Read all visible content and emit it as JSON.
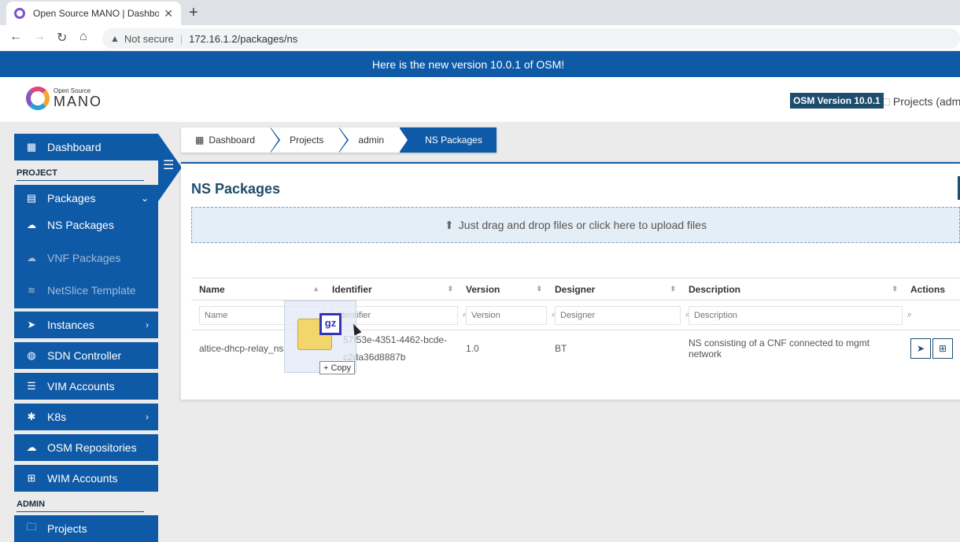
{
  "browser": {
    "tab_title": "Open Source MANO | Dashboard",
    "new_tab": "+",
    "not_secure": "Not secure",
    "url": "172.16.1.2/packages/ns"
  },
  "banner": "Here is the new version 10.0.1 of OSM!",
  "header": {
    "logo_small": "Open Source",
    "logo_big": "MANO",
    "version": "OSM Version 10.0.1",
    "projects": "Projects (admin"
  },
  "sidebar": {
    "dashboard": "Dashboard",
    "project_section": "PROJECT",
    "packages": "Packages",
    "ns_packages": "NS Packages",
    "vnf_packages": "VNF Packages",
    "netslice": "NetSlice Template",
    "instances": "Instances",
    "sdn": "SDN Controller",
    "vim": "VIM Accounts",
    "k8s": "K8s",
    "osm_repos": "OSM Repositories",
    "wim": "WIM Accounts",
    "admin_section": "ADMIN",
    "projects": "Projects"
  },
  "breadcrumb": [
    "Dashboard",
    "Projects",
    "admin",
    "NS Packages"
  ],
  "page": {
    "title": "NS Packages",
    "dropzone": "Just drag and drop files or click here to upload files"
  },
  "table": {
    "headers": [
      "Name",
      "Identifier",
      "Version",
      "Designer",
      "Description",
      "Actions"
    ],
    "placeholders": [
      "Name",
      "Identifier",
      "Version",
      "Designer",
      "Description"
    ],
    "rows": [
      {
        "name": "altice-dhcp-relay_ns",
        "identifier_line1": "57f53e-4351-4462-bcde-",
        "identifier_line2": "c2da36d8887b",
        "version": "1.0",
        "designer": "BT",
        "description": "NS consisting of a CNF connected to mgmt network"
      }
    ]
  },
  "drag": {
    "file_badge": "gz",
    "copy_label": "Copy"
  }
}
